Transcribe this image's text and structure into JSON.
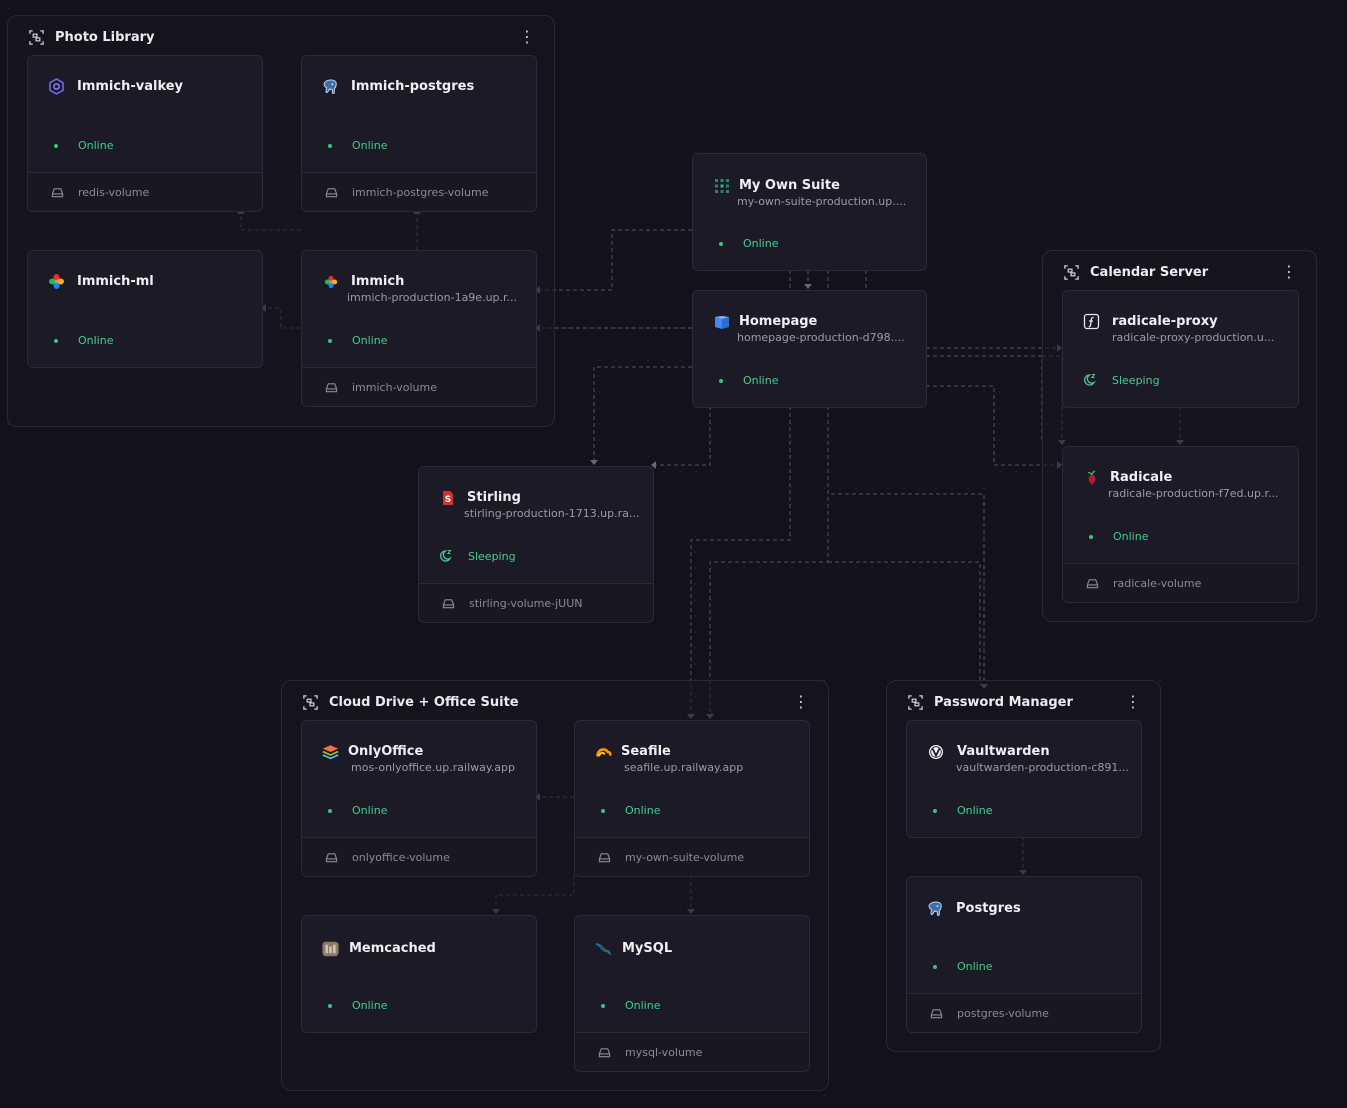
{
  "groups": {
    "photo_library": {
      "title": "Photo Library"
    },
    "calendar_server": {
      "title": "Calendar Server"
    },
    "cloud_drive": {
      "title": "Cloud Drive + Office Suite"
    },
    "password_manager": {
      "title": "Password Manager"
    }
  },
  "kebab": "⋮",
  "services": {
    "immich_valkey": {
      "name": "Immich-valkey",
      "status": "Online",
      "volume": "redis-volume",
      "icon": "valkey-icon"
    },
    "immich_postgres": {
      "name": "Immich-postgres",
      "status": "Online",
      "volume": "immich-postgres-volume",
      "icon": "postgres-icon"
    },
    "immich_ml": {
      "name": "Immich-ml",
      "status": "Online",
      "icon": "immich-icon"
    },
    "immich": {
      "name": "Immich",
      "url": "immich-production-1a9e.up.r...",
      "status": "Online",
      "volume": "immich-volume",
      "icon": "immich-icon"
    },
    "my_own_suite": {
      "name": "My Own Suite",
      "url": "my-own-suite-production.up....",
      "status": "Online",
      "icon": "grid-icon"
    },
    "homepage": {
      "name": "Homepage",
      "url": "homepage-production-d798....",
      "status": "Online",
      "icon": "homepage-icon"
    },
    "radicale_proxy": {
      "name": "radicale-proxy",
      "url": "radicale-proxy-production.u...",
      "status": "Sleeping",
      "icon": "function-icon"
    },
    "radicale": {
      "name": "Radicale",
      "url": "radicale-production-f7ed.up.r...",
      "status": "Online",
      "volume": "radicale-volume",
      "icon": "radicale-icon"
    },
    "stirling": {
      "name": "Stirling",
      "url": "stirling-production-1713.up.ra...",
      "status": "Sleeping",
      "volume": "stirling-volume-jUUN",
      "icon": "stirling-icon"
    },
    "onlyoffice": {
      "name": "OnlyOffice",
      "url": "mos-onlyoffice.up.railway.app",
      "status": "Online",
      "volume": "onlyoffice-volume",
      "icon": "onlyoffice-icon"
    },
    "seafile": {
      "name": "Seafile",
      "url": "seafile.up.railway.app",
      "status": "Online",
      "volume": "my-own-suite-volume",
      "icon": "seafile-icon"
    },
    "memcached": {
      "name": "Memcached",
      "status": "Online",
      "icon": "memcached-icon"
    },
    "mysql": {
      "name": "MySQL",
      "status": "Online",
      "volume": "mysql-volume",
      "icon": "mysql-icon"
    },
    "vaultwarden": {
      "name": "Vaultwarden",
      "url": "vaultwarden-production-c891...",
      "status": "Online",
      "icon": "vaultwarden-icon"
    },
    "postgres": {
      "name": "Postgres",
      "status": "Online",
      "volume": "postgres-volume",
      "icon": "postgres-icon"
    }
  },
  "colors": {
    "background": "#13111b",
    "card": "#1c1a26",
    "online": "#3fcf8e",
    "edge": "#55525f"
  }
}
